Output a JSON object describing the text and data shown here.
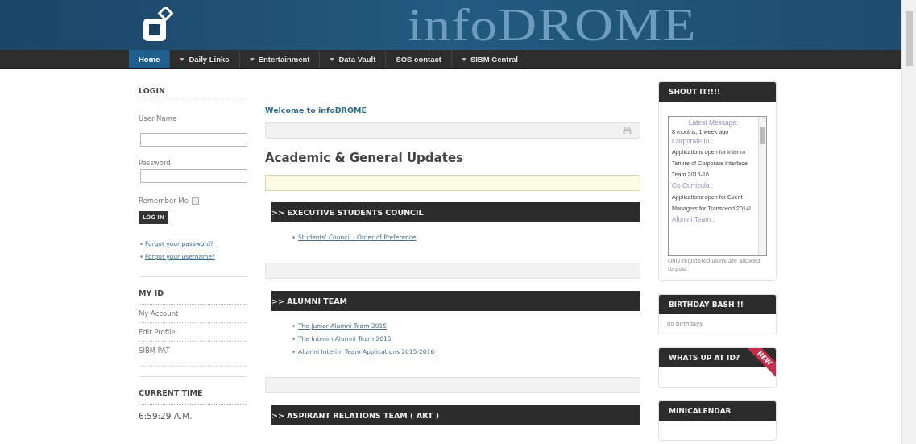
{
  "banner": {
    "logo_text": "infoDROME"
  },
  "nav": [
    {
      "label": "Home",
      "selected": true,
      "dropdown": false
    },
    {
      "label": "Daily Links",
      "selected": false,
      "dropdown": true
    },
    {
      "label": "Entertainment",
      "selected": false,
      "dropdown": true
    },
    {
      "label": "Data Vault",
      "selected": false,
      "dropdown": true
    },
    {
      "label": "SOS contact",
      "selected": false,
      "dropdown": false
    },
    {
      "label": "SIBM Central",
      "selected": false,
      "dropdown": true
    }
  ],
  "login": {
    "title": "LOGIN",
    "username_label": "User Name",
    "password_label": "Password",
    "remember_label": "Remember Me",
    "remember_checked": false,
    "button": "LOG IN",
    "links": [
      "Forgot your password?",
      "Forgot your username?"
    ]
  },
  "my_id": {
    "title": "MY ID",
    "items": [
      "My Account",
      "Edit Profile",
      "SIBM PAT"
    ]
  },
  "current_time": {
    "title": "CURRENT TIME",
    "value": "6:59:29 A.M."
  },
  "main": {
    "welcome_link": "Welcome to infoDROME",
    "heading": "Academic & General Updates",
    "sections": [
      {
        "title": ">> EXECUTIVE STUDENTS COUNCIL",
        "links": [
          "Students' Council - Order of Preference"
        ]
      },
      {
        "title": ">> ALUMNI TEAM",
        "links": [
          "The Junior Alumni Team 2015",
          "The Interim Alumni Team 2015",
          "Alumni Interim Team Applications 2015-2016"
        ]
      },
      {
        "title": ">> ASPIRANT RELATIONS TEAM ( ART )"
      }
    ]
  },
  "shoutbox": {
    "title": "SHOUT IT!!!!",
    "latest_label": "Latest Message:",
    "latest_time": "8 months, 1 week ago",
    "messages": [
      {
        "author": "Corporate In :",
        "text": "Applications open for Interim Tenure of Corporate Interface Team 2015-16"
      },
      {
        "author": "Co Curricula :",
        "text": "Applications open for Event Managers for Transcend 2014!"
      },
      {
        "author": "Alumni Team :"
      }
    ],
    "note": "Only registered users are allowed to post"
  },
  "modules": [
    {
      "title": "BIRTHDAY BASH !!",
      "body": "no birthdays"
    },
    {
      "title": "WHATS UP AT ID?",
      "badge": "NEW"
    },
    {
      "title": "MINICALENDAR"
    }
  ]
}
